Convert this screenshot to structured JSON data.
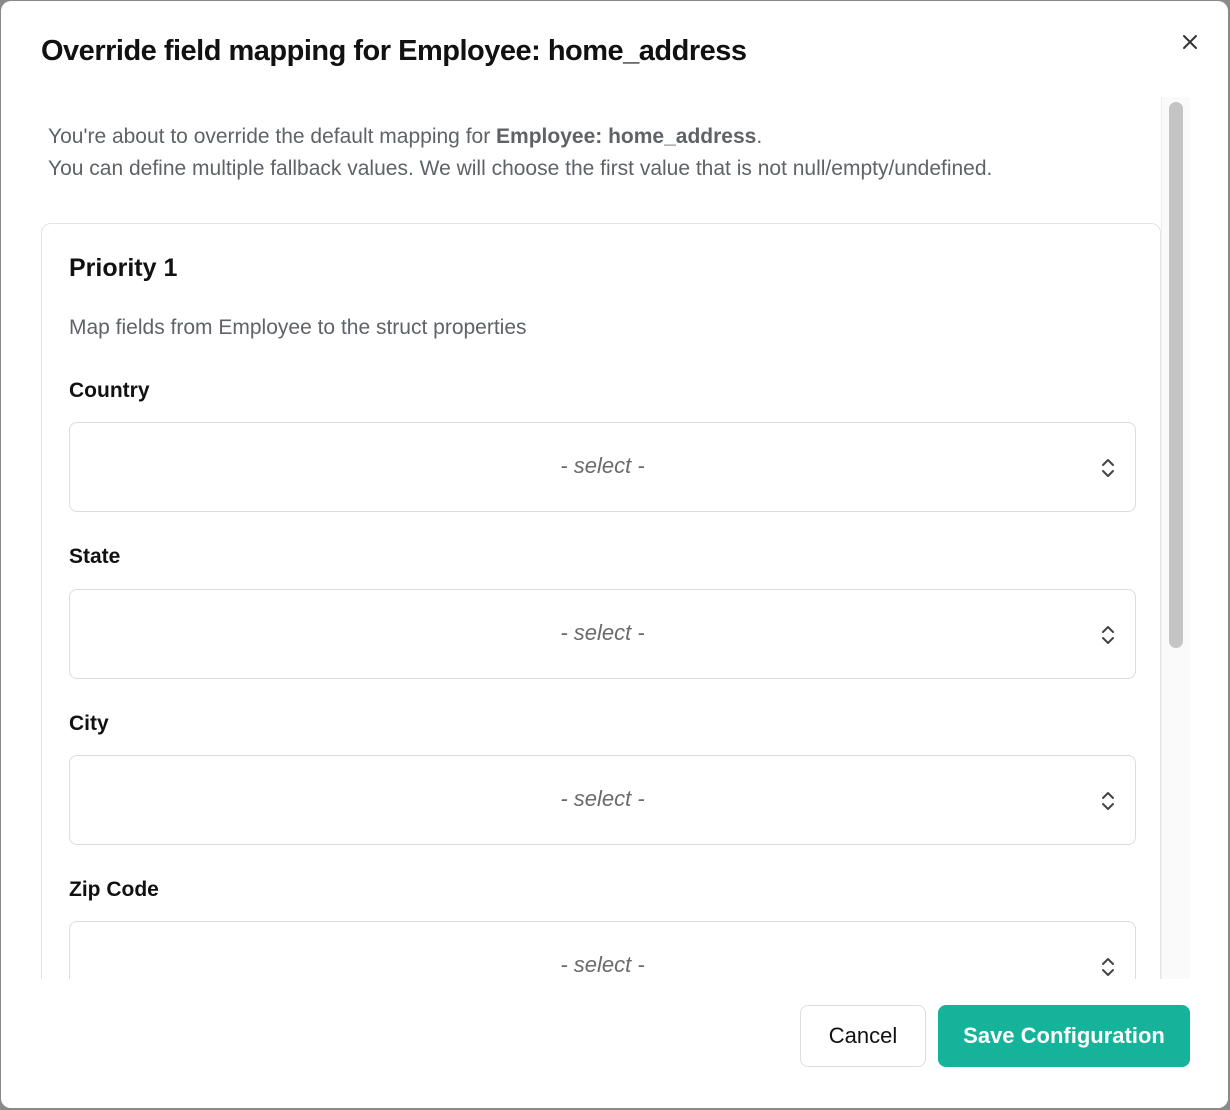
{
  "modal": {
    "title": "Override field mapping for Employee: home_address"
  },
  "intro": {
    "prefix": "You're about to override the default mapping for ",
    "entity": "Employee: home_address",
    "suffix": ".",
    "line2": "You can define multiple fallback values. We will choose the first value that is not null/empty/undefined."
  },
  "priority_card": {
    "title": "Priority 1",
    "description": "Map fields from Employee to the struct properties",
    "fields": [
      {
        "label": "Country",
        "value": "- select -"
      },
      {
        "label": "State",
        "value": "- select -"
      },
      {
        "label": "City",
        "value": "- select -"
      },
      {
        "label": "Zip Code",
        "value": "- select -"
      }
    ]
  },
  "footer": {
    "cancel_label": "Cancel",
    "save_label": "Save Configuration"
  },
  "colors": {
    "primary": "#16b39b",
    "text": "#111111",
    "muted": "#5f6368",
    "border": "#dcdcdc"
  },
  "icons": {
    "close": "close-icon",
    "select": "chevron-up-down-icon"
  }
}
